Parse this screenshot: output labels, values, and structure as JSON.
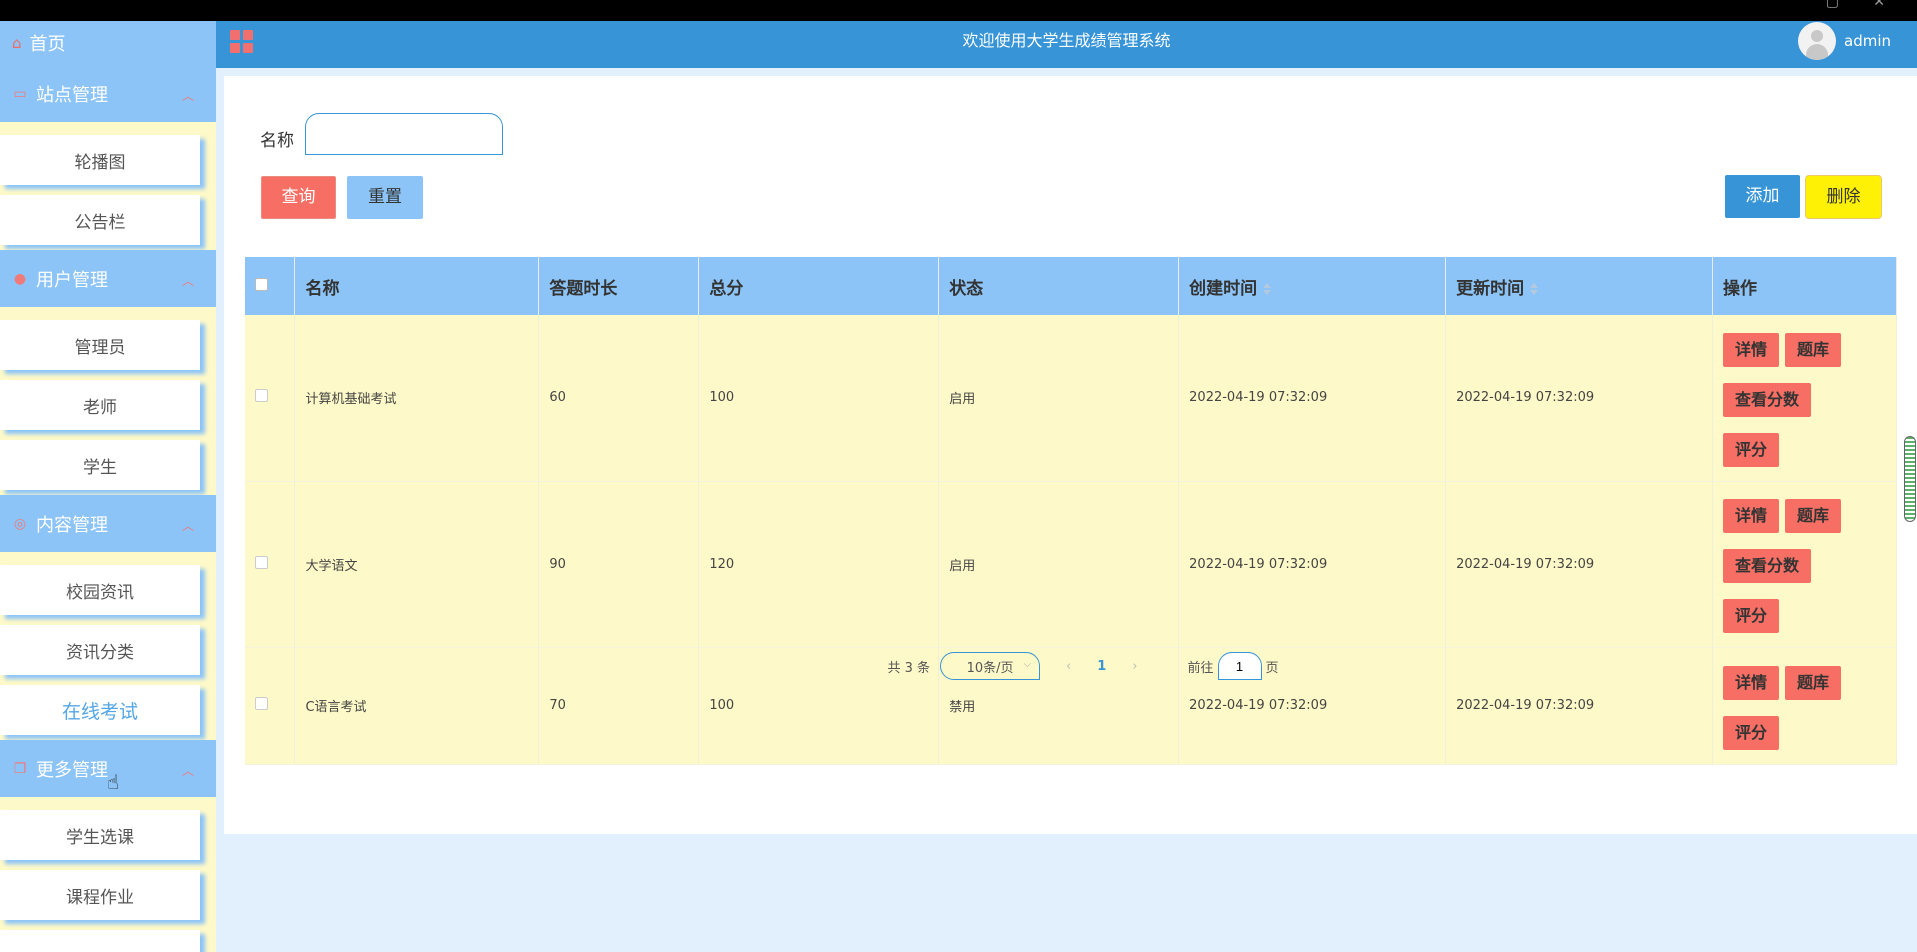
{
  "header": {
    "title": "欢迎使用大学生成绩管理系统",
    "username": "admin"
  },
  "sidebar": {
    "home": "首页",
    "groups": [
      {
        "label": "站点管理",
        "items": [
          "轮播图",
          "公告栏"
        ]
      },
      {
        "label": "用户管理",
        "items": [
          "管理员",
          "老师",
          "学生"
        ]
      },
      {
        "label": "内容管理",
        "items": [
          "校园资讯",
          "资讯分类",
          "在线考试"
        ]
      },
      {
        "label": "更多管理",
        "items": [
          "学生选课",
          "课程作业"
        ]
      }
    ],
    "active_item": "在线考试"
  },
  "search": {
    "label": "名称",
    "value": "",
    "query_btn": "查询",
    "reset_btn": "重置"
  },
  "actions": {
    "add": "添加",
    "delete": "删除"
  },
  "table": {
    "headers": [
      "名称",
      "答题时长",
      "总分",
      "状态",
      "创建时间",
      "更新时间",
      "操作"
    ],
    "rows": [
      {
        "name": "计算机基础考试",
        "duration": "60",
        "total": "100",
        "status": "启用",
        "created": "2022-04-19 07:32:09",
        "updated": "2022-04-19 07:32:09",
        "ops": [
          "详情",
          "题库",
          "查看分数",
          "评分"
        ]
      },
      {
        "name": "大学语文",
        "duration": "90",
        "total": "120",
        "status": "启用",
        "created": "2022-04-19 07:32:09",
        "updated": "2022-04-19 07:32:09",
        "ops": [
          "详情",
          "题库",
          "查看分数",
          "评分"
        ]
      },
      {
        "name": "C语言考试",
        "duration": "70",
        "total": "100",
        "status": "禁用",
        "created": "2022-04-19 07:32:09",
        "updated": "2022-04-19 07:32:09",
        "ops": [
          "详情",
          "题库",
          "评分"
        ]
      }
    ]
  },
  "pagination": {
    "total": "共 3 条",
    "page_size": "10条/页",
    "prev": "‹",
    "current": "1",
    "next": "›",
    "goto_label": "前往",
    "goto_value": "1",
    "page_suffix": "页"
  },
  "colors": {
    "header": "#3694d7",
    "sidebar_group": "#8cc4f7",
    "row_bg": "#fef9c8",
    "danger": "#f76f64",
    "delete": "#fef106"
  },
  "icons": {
    "home": "home-icon",
    "site": "monitor-icon",
    "user": "user-icon",
    "content": "chat-icon",
    "more": "copy-icon",
    "menu": "grid-icon"
  }
}
